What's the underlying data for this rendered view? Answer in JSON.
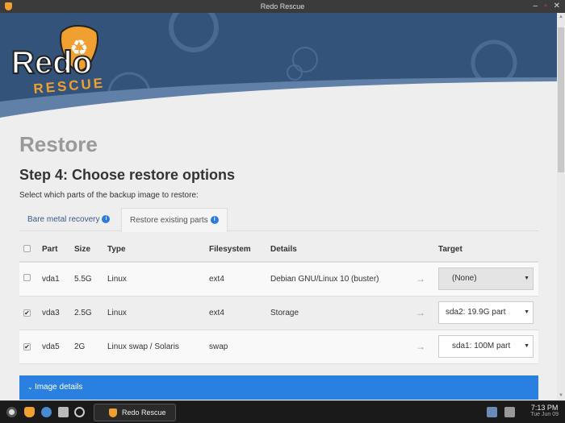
{
  "window": {
    "title": "Redo Rescue"
  },
  "logo": {
    "word": "Redo",
    "sub": "RESCUE"
  },
  "page": {
    "title": "Restore",
    "step": "Step 4: Choose restore options",
    "subtitle": "Select which parts of the backup image to restore:"
  },
  "tabs": [
    {
      "label": "Bare metal recovery"
    },
    {
      "label": "Restore existing parts"
    }
  ],
  "table": {
    "headers": {
      "part": "Part",
      "size": "Size",
      "type": "Type",
      "fs": "Filesystem",
      "details": "Details",
      "target": "Target"
    },
    "rows": [
      {
        "checked": false,
        "part": "vda1",
        "size": "5.5G",
        "type": "Linux",
        "fs": "ext4",
        "details": "Debian GNU/Linux 10 (buster)",
        "target": "(None)"
      },
      {
        "checked": true,
        "part": "vda3",
        "size": "2.5G",
        "type": "Linux",
        "fs": "ext4",
        "details": "Storage",
        "target": "sda2: 19.9G part"
      },
      {
        "checked": true,
        "part": "vda5",
        "size": "2G",
        "type": "Linux swap / Solaris",
        "fs": "swap",
        "details": "",
        "target": "sda1: 100M part"
      }
    ]
  },
  "image_details": "Image details",
  "taskbar": {
    "task": "Redo Rescue",
    "time": "7:13 PM",
    "date": "Tue Jun 09"
  },
  "colors": {
    "accent": "#2a80e0",
    "banner": "#34537a",
    "orange": "#f0a030"
  }
}
